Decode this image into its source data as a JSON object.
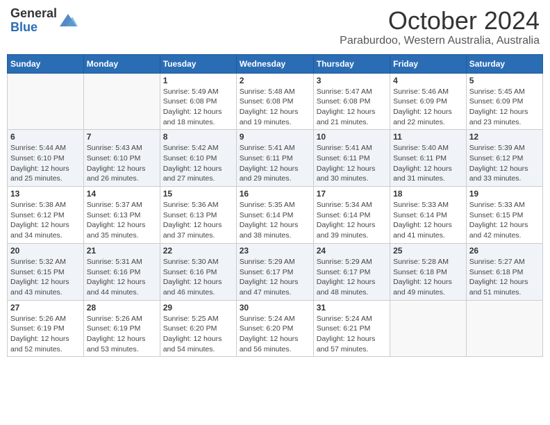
{
  "header": {
    "logo": {
      "general": "General",
      "blue": "Blue"
    },
    "title": "October 2024",
    "subtitle": "Paraburdoo, Western Australia, Australia"
  },
  "days_of_week": [
    "Sunday",
    "Monday",
    "Tuesday",
    "Wednesday",
    "Thursday",
    "Friday",
    "Saturday"
  ],
  "weeks": [
    [
      {
        "day": "",
        "info": ""
      },
      {
        "day": "",
        "info": ""
      },
      {
        "day": "1",
        "info": "Sunrise: 5:49 AM\nSunset: 6:08 PM\nDaylight: 12 hours and 18 minutes."
      },
      {
        "day": "2",
        "info": "Sunrise: 5:48 AM\nSunset: 6:08 PM\nDaylight: 12 hours and 19 minutes."
      },
      {
        "day": "3",
        "info": "Sunrise: 5:47 AM\nSunset: 6:08 PM\nDaylight: 12 hours and 21 minutes."
      },
      {
        "day": "4",
        "info": "Sunrise: 5:46 AM\nSunset: 6:09 PM\nDaylight: 12 hours and 22 minutes."
      },
      {
        "day": "5",
        "info": "Sunrise: 5:45 AM\nSunset: 6:09 PM\nDaylight: 12 hours and 23 minutes."
      }
    ],
    [
      {
        "day": "6",
        "info": "Sunrise: 5:44 AM\nSunset: 6:10 PM\nDaylight: 12 hours and 25 minutes."
      },
      {
        "day": "7",
        "info": "Sunrise: 5:43 AM\nSunset: 6:10 PM\nDaylight: 12 hours and 26 minutes."
      },
      {
        "day": "8",
        "info": "Sunrise: 5:42 AM\nSunset: 6:10 PM\nDaylight: 12 hours and 27 minutes."
      },
      {
        "day": "9",
        "info": "Sunrise: 5:41 AM\nSunset: 6:11 PM\nDaylight: 12 hours and 29 minutes."
      },
      {
        "day": "10",
        "info": "Sunrise: 5:41 AM\nSunset: 6:11 PM\nDaylight: 12 hours and 30 minutes."
      },
      {
        "day": "11",
        "info": "Sunrise: 5:40 AM\nSunset: 6:11 PM\nDaylight: 12 hours and 31 minutes."
      },
      {
        "day": "12",
        "info": "Sunrise: 5:39 AM\nSunset: 6:12 PM\nDaylight: 12 hours and 33 minutes."
      }
    ],
    [
      {
        "day": "13",
        "info": "Sunrise: 5:38 AM\nSunset: 6:12 PM\nDaylight: 12 hours and 34 minutes."
      },
      {
        "day": "14",
        "info": "Sunrise: 5:37 AM\nSunset: 6:13 PM\nDaylight: 12 hours and 35 minutes."
      },
      {
        "day": "15",
        "info": "Sunrise: 5:36 AM\nSunset: 6:13 PM\nDaylight: 12 hours and 37 minutes."
      },
      {
        "day": "16",
        "info": "Sunrise: 5:35 AM\nSunset: 6:14 PM\nDaylight: 12 hours and 38 minutes."
      },
      {
        "day": "17",
        "info": "Sunrise: 5:34 AM\nSunset: 6:14 PM\nDaylight: 12 hours and 39 minutes."
      },
      {
        "day": "18",
        "info": "Sunrise: 5:33 AM\nSunset: 6:14 PM\nDaylight: 12 hours and 41 minutes."
      },
      {
        "day": "19",
        "info": "Sunrise: 5:33 AM\nSunset: 6:15 PM\nDaylight: 12 hours and 42 minutes."
      }
    ],
    [
      {
        "day": "20",
        "info": "Sunrise: 5:32 AM\nSunset: 6:15 PM\nDaylight: 12 hours and 43 minutes."
      },
      {
        "day": "21",
        "info": "Sunrise: 5:31 AM\nSunset: 6:16 PM\nDaylight: 12 hours and 44 minutes."
      },
      {
        "day": "22",
        "info": "Sunrise: 5:30 AM\nSunset: 6:16 PM\nDaylight: 12 hours and 46 minutes."
      },
      {
        "day": "23",
        "info": "Sunrise: 5:29 AM\nSunset: 6:17 PM\nDaylight: 12 hours and 47 minutes."
      },
      {
        "day": "24",
        "info": "Sunrise: 5:29 AM\nSunset: 6:17 PM\nDaylight: 12 hours and 48 minutes."
      },
      {
        "day": "25",
        "info": "Sunrise: 5:28 AM\nSunset: 6:18 PM\nDaylight: 12 hours and 49 minutes."
      },
      {
        "day": "26",
        "info": "Sunrise: 5:27 AM\nSunset: 6:18 PM\nDaylight: 12 hours and 51 minutes."
      }
    ],
    [
      {
        "day": "27",
        "info": "Sunrise: 5:26 AM\nSunset: 6:19 PM\nDaylight: 12 hours and 52 minutes."
      },
      {
        "day": "28",
        "info": "Sunrise: 5:26 AM\nSunset: 6:19 PM\nDaylight: 12 hours and 53 minutes."
      },
      {
        "day": "29",
        "info": "Sunrise: 5:25 AM\nSunset: 6:20 PM\nDaylight: 12 hours and 54 minutes."
      },
      {
        "day": "30",
        "info": "Sunrise: 5:24 AM\nSunset: 6:20 PM\nDaylight: 12 hours and 56 minutes."
      },
      {
        "day": "31",
        "info": "Sunrise: 5:24 AM\nSunset: 6:21 PM\nDaylight: 12 hours and 57 minutes."
      },
      {
        "day": "",
        "info": ""
      },
      {
        "day": "",
        "info": ""
      }
    ]
  ]
}
